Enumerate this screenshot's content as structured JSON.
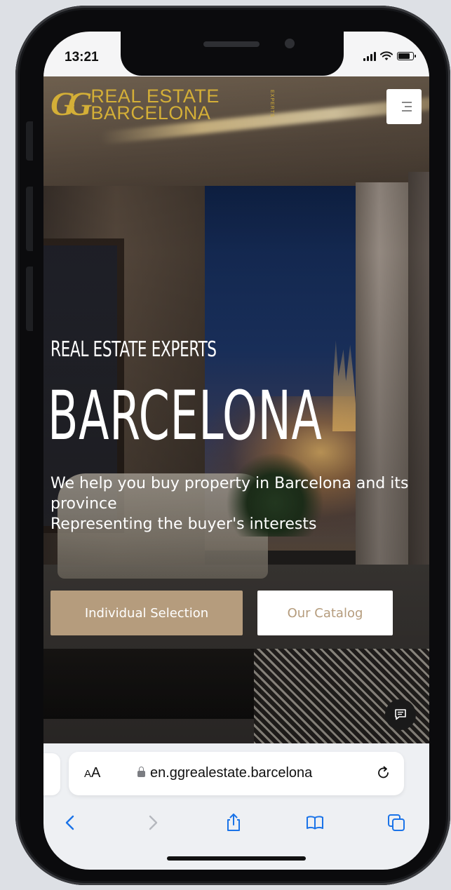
{
  "status_bar": {
    "time": "13:21"
  },
  "header": {
    "logo_mark": "GG",
    "logo_line1": "REAL ESTATE",
    "logo_line2": "BARCELONA",
    "logo_side": "EXPERTS"
  },
  "hero": {
    "subtitle": "REAL ESTATE EXPERTS",
    "title": "BARCELONA",
    "desc_line1": "We help you buy property in Barcelona and its province",
    "desc_line2": "Representing the buyer's interests"
  },
  "cta": {
    "primary_label": "Individual Selection",
    "secondary_label": "Our Catalog"
  },
  "safari": {
    "aa_small": "A",
    "aa_big": "A",
    "url": "en.ggrealestate.barcelona"
  },
  "colors": {
    "brand_gold": "#d4af37",
    "button_tan": "#b59c7d",
    "ios_blue": "#1a73e8"
  },
  "icons": {
    "menu": "hamburger-icon",
    "chat": "chat-bubble-icon",
    "lock": "lock-icon",
    "reload": "reload-icon",
    "back": "chevron-left-icon",
    "forward": "chevron-right-icon",
    "share": "share-icon",
    "bookmarks": "book-icon",
    "tabs": "tabs-icon"
  }
}
